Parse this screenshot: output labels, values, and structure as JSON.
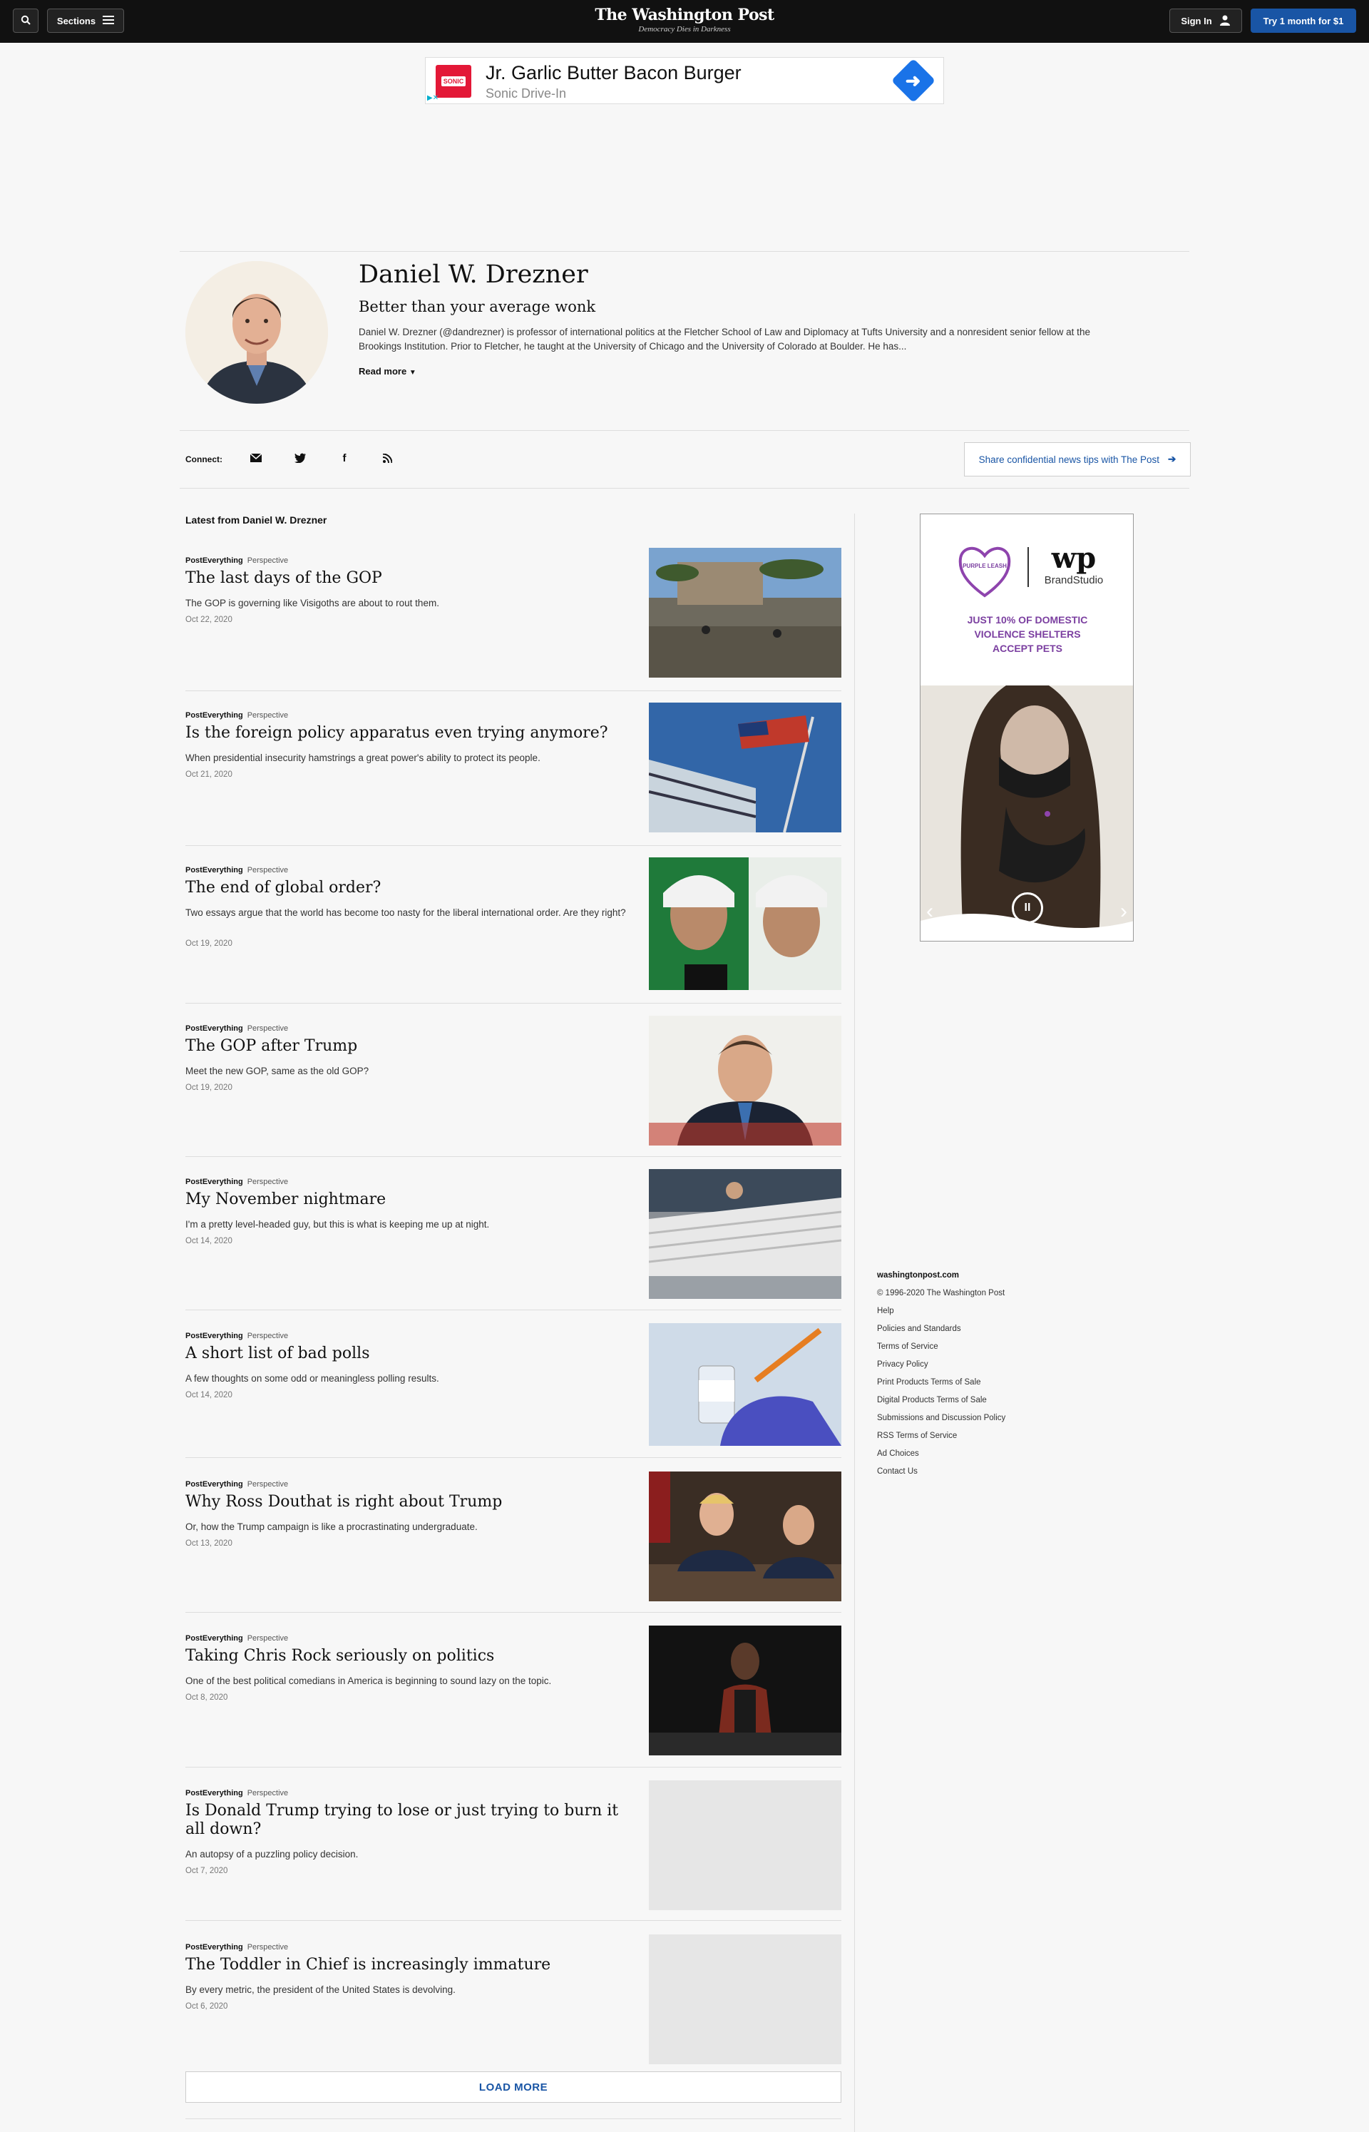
{
  "header": {
    "sections_label": "Sections",
    "logo": "The Washington Post",
    "tagline": "Democracy Dies in Darkness",
    "signin_label": "Sign In",
    "subscribe_label": "Try 1 month for $1"
  },
  "top_ad": {
    "brand_badge": "SONIC",
    "title": "Jr. Garlic Butter Bacon Burger",
    "subtitle": "Sonic Drive-In"
  },
  "author": {
    "name": "Daniel W. Drezner",
    "tagline": "Better than your average wonk",
    "bio": "Daniel W. Drezner (@dandrezner) is professor of international politics at the Fletcher School of Law and Diplomacy at Tufts University and a nonresident senior fellow at the Brookings Institution. Prior to Fletcher, he taught at the University of Chicago and the University of Colorado at Boulder. He has...",
    "read_more": "Read more"
  },
  "connect": {
    "label": "Connect:",
    "share_label": "Share confidential news tips with The Post"
  },
  "latest_heading": "Latest from Daniel W. Drezner",
  "articles": [
    {
      "section": "PostEverything",
      "label": "Perspective",
      "headline": "The last days of the GOP",
      "blurb": "The GOP is governing like Visigoths are about to rout them.",
      "date": "Oct 22, 2020"
    },
    {
      "section": "PostEverything",
      "label": "Perspective",
      "headline": "Is the foreign policy apparatus even trying anymore?",
      "blurb": "When presidential insecurity hamstrings a great power's ability to protect its people.",
      "date": "Oct 21, 2020"
    },
    {
      "section": "PostEverything",
      "label": "Perspective",
      "headline": "The end of global order?",
      "blurb": "Two essays argue that the world has become too nasty for the liberal international order. Are they right?",
      "date": "Oct 19, 2020"
    },
    {
      "section": "PostEverything",
      "label": "Perspective",
      "headline": "The GOP after Trump",
      "blurb": "Meet the new GOP, same as the old GOP?",
      "date": "Oct 19, 2020"
    },
    {
      "section": "PostEverything",
      "label": "Perspective",
      "headline": "My November nightmare",
      "blurb": "I'm a pretty level-headed guy, but this is what is keeping me up at night.",
      "date": "Oct 14, 2020"
    },
    {
      "section": "PostEverything",
      "label": "Perspective",
      "headline": "A short list of bad polls",
      "blurb": "A few thoughts on some odd or meaningless polling results.",
      "date": "Oct 14, 2020"
    },
    {
      "section": "PostEverything",
      "label": "Perspective",
      "headline": "Why Ross Douthat is right about Trump",
      "blurb": "Or, how the Trump campaign is like a procrastinating undergraduate.",
      "date": "Oct 13, 2020"
    },
    {
      "section": "PostEverything",
      "label": "Perspective",
      "headline": "Taking Chris Rock seriously on politics",
      "blurb": "One of the best political comedians in America is beginning to sound lazy on the topic.",
      "date": "Oct 8, 2020"
    },
    {
      "section": "PostEverything",
      "label": "Perspective",
      "headline": "Is Donald Trump trying to lose or just trying to burn it all down?",
      "blurb": "An autopsy of a puzzling policy decision.",
      "date": "Oct 7, 2020"
    },
    {
      "section": "PostEverything",
      "label": "Perspective",
      "headline": "The Toddler in Chief is increasingly immature",
      "blurb": "By every metric, the president of the United States is devolving.",
      "date": "Oct 6, 2020"
    }
  ],
  "load_more": "LOAD MORE",
  "side_ad": {
    "logo_text": "PURPLE LEASH",
    "brand": "wp",
    "brand_studio": "BrandStudio",
    "headline": "JUST 10% OF DOMESTIC VIOLENCE SHELTERS ACCEPT PETS"
  },
  "footer": {
    "title": "washingtonpost.com",
    "copyright": "© 1996-2020 The Washington Post",
    "links": [
      "Help",
      "Policies and Standards",
      "Terms of Service",
      "Privacy Policy",
      "Print Products Terms of Sale",
      "Digital Products Terms of Sale",
      "Submissions and Discussion Policy",
      "RSS Terms of Service",
      "Ad Choices",
      "Contact Us"
    ]
  },
  "colors": {
    "accent": "#1955a5",
    "topbar": "#111111",
    "ad_purple": "#7b3fa0"
  }
}
